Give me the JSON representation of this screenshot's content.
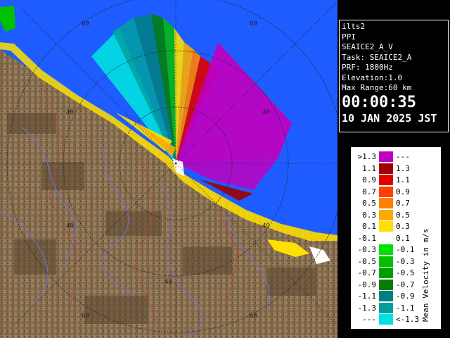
{
  "info": {
    "station": "ilts2",
    "product": "PPI",
    "scan": "SEAICE2_A_V",
    "task": "Task: SEAICE2_A",
    "prf": "PRF: 1800Hz",
    "elevation": "Elevation:1.0",
    "max_range": "Max Range:60 km",
    "time": "00:00:35",
    "date": "10 JAN 2025 JST"
  },
  "map_labels": {
    "ring_top_left": "60",
    "ring_top_right": "60",
    "ring_upper_left": "40",
    "ring_upper_right": "40",
    "ring_lower_left": "40",
    "ring_lower_right": "40",
    "ring_bottom_center": "40",
    "ring_bottom_left": "60",
    "ring_bottom_right": "60"
  },
  "legend": {
    "title": "Mean Velocity in m/s",
    "rows": [
      {
        "left": ">1.3",
        "right": "---",
        "color": "#c000c0"
      },
      {
        "left": "1.1",
        "right": "1.3",
        "color": "#a00000"
      },
      {
        "left": "0.9",
        "right": "1.1",
        "color": "#e00000"
      },
      {
        "left": "0.7",
        "right": "0.9",
        "color": "#ff4000"
      },
      {
        "left": "0.5",
        "right": "0.7",
        "color": "#ff8000"
      },
      {
        "left": "0.3",
        "right": "0.5",
        "color": "#ffa800"
      },
      {
        "left": "0.1",
        "right": "0.3",
        "color": "#ffe000"
      },
      {
        "left": "-0.1",
        "right": "0.1",
        "color": "#ffffff"
      },
      {
        "left": "-0.3",
        "right": "-0.1",
        "color": "#00e000"
      },
      {
        "left": "-0.5",
        "right": "-0.3",
        "color": "#00c000"
      },
      {
        "left": "-0.7",
        "right": "-0.5",
        "color": "#00a000"
      },
      {
        "left": "-0.9",
        "right": "-0.7",
        "color": "#008000"
      },
      {
        "left": "-1.1",
        "right": "-0.9",
        "color": "#008080"
      },
      {
        "left": "-1.3",
        "right": "-1.1",
        "color": "#00a0a0"
      },
      {
        "left": "---",
        "right": "<-1.3",
        "color": "#00e0e0"
      }
    ]
  },
  "colors": {
    "sea": "#1e5cff",
    "land": "#8a7152",
    "land_dark": "#6b553b",
    "rings": "#333333"
  }
}
